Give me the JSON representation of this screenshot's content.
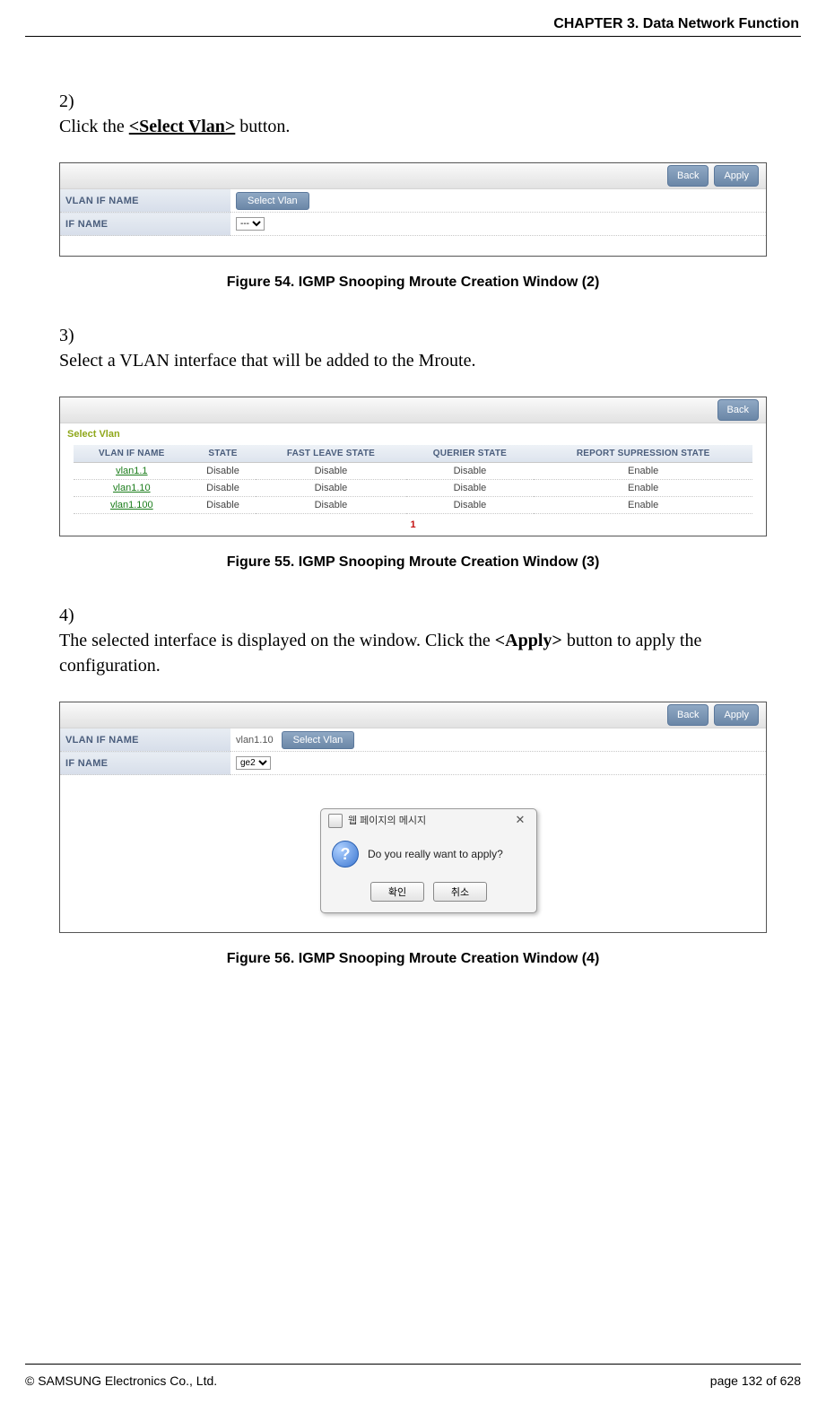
{
  "header": {
    "chapter": "CHAPTER 3. Data Network Function"
  },
  "steps": {
    "s2": {
      "num": "2)",
      "pre": "Click the ",
      "bold": "<Select Vlan>",
      "post": " button."
    },
    "s3": {
      "num": "3)",
      "text": "Select a VLAN interface that will be added to the Mroute."
    },
    "s4": {
      "num": "4)",
      "pre": "The selected interface is displayed on the window. Click the ",
      "bold": "<Apply>",
      "post": " button to apply the configuration."
    }
  },
  "captions": {
    "c54": "Figure 54. IGMP Snooping Mroute Creation Window (2)",
    "c55": "Figure 55. IGMP Snooping Mroute Creation Window (3)",
    "c56": "Figure 56. IGMP Snooping Mroute Creation Window (4)"
  },
  "ui_common": {
    "back": "Back",
    "apply": "Apply",
    "select_vlan_btn": "Select Vlan"
  },
  "fig54": {
    "rows": {
      "vlan_label": "VLAN IF NAME",
      "vlan_value": "",
      "if_label": "IF NAME",
      "if_value": "---"
    }
  },
  "fig55": {
    "title": "Select Vlan",
    "headers": {
      "vlan": "VLAN IF NAME",
      "state": "STATE",
      "fast": "FAST LEAVE STATE",
      "querier": "QUERIER STATE",
      "report": "REPORT SUPRESSION STATE"
    },
    "rows": [
      {
        "name": "vlan1.1",
        "state": "Disable",
        "fast": "Disable",
        "querier": "Disable",
        "report": "Enable"
      },
      {
        "name": "vlan1.10",
        "state": "Disable",
        "fast": "Disable",
        "querier": "Disable",
        "report": "Enable"
      },
      {
        "name": "vlan1.100",
        "state": "Disable",
        "fast": "Disable",
        "querier": "Disable",
        "report": "Enable"
      }
    ],
    "pager": "1"
  },
  "fig56": {
    "rows": {
      "vlan_label": "VLAN IF NAME",
      "vlan_value": "vlan1.10",
      "if_label": "IF NAME",
      "if_value": "ge2"
    },
    "modal": {
      "title": "웹 페이지의 메시지",
      "message": "Do you really want to apply?",
      "ok": "확인",
      "cancel": "취소",
      "close_glyph": "✕"
    }
  },
  "footer": {
    "left": "©  SAMSUNG Electronics Co., Ltd.",
    "right": "page 132 of 628"
  }
}
